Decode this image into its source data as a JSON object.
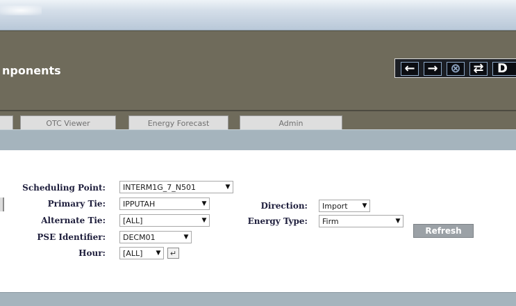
{
  "header": {
    "title": "nponents",
    "toolbar": [
      {
        "name": "back-arrow-icon",
        "glyph": "←"
      },
      {
        "name": "forward-arrow-icon",
        "glyph": "→"
      },
      {
        "name": "cancel-circle-icon",
        "glyph": "⊗"
      },
      {
        "name": "swap-refresh-icon",
        "glyph": "⇄"
      },
      {
        "name": "print-icon",
        "glyph": "D"
      }
    ]
  },
  "tabs": [
    {
      "label": "OTC Viewer"
    },
    {
      "label": "Energy Forecast"
    },
    {
      "label": "Admin"
    }
  ],
  "form": {
    "scheduling_point": {
      "label": "Scheduling Point:",
      "value": "INTERM1G_7_N501"
    },
    "primary_tie": {
      "label": "Primary Tie:",
      "value": "IPPUTAH"
    },
    "alternate_tie": {
      "label": "Alternate Tie:",
      "value": "[ALL]"
    },
    "pse_identifier": {
      "label": "PSE Identifier:",
      "value": "DECM01"
    },
    "hour": {
      "label": "Hour:",
      "value": "[ALL]"
    },
    "direction": {
      "label": "Direction:",
      "value": "Import"
    },
    "energy_type": {
      "label": "Energy Type:",
      "value": "Firm"
    },
    "refresh_label": "Refresh"
  },
  "colors": {
    "header_bg": "#6f6b5b",
    "band_bg": "#a5b4bd",
    "label_text": "#1e1e3c",
    "refresh_bg": "#9ba1a6"
  }
}
